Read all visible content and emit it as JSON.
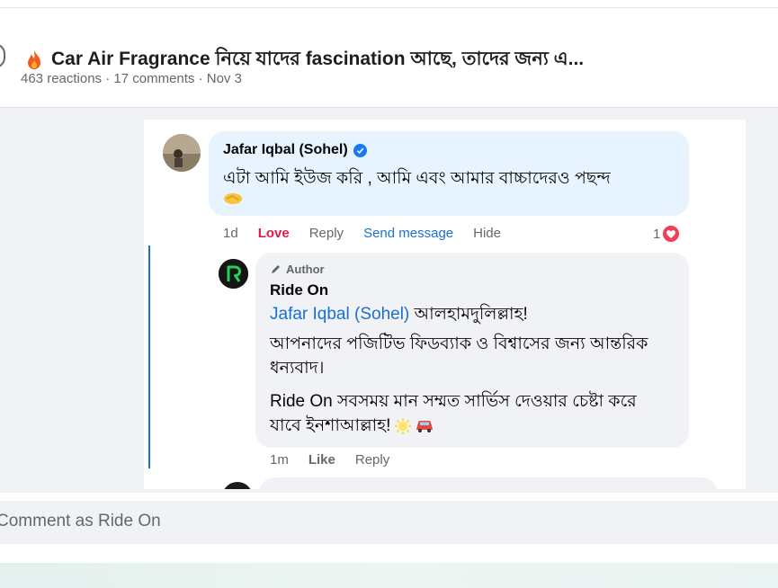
{
  "post": {
    "title": "Car Air Fragrance নিয়ে যাদের fascination আছে, তাদের জন্য এ...",
    "meta": "463 reactions · 17 comments · Nov 3",
    "title_icon": "fire-icon"
  },
  "comments": [
    {
      "author": "Jafar Iqbal (Sohel)",
      "verified": true,
      "text": "এটা আমি ইউজ করি , আমি এবং আমার বাচ্চাদেরও পছন্দ",
      "emoji": "handshake-emoji",
      "actions": {
        "time": "1d",
        "love": "Love",
        "reply": "Reply",
        "send_message": "Send message",
        "hide": "Hide"
      },
      "reaction_count": "1",
      "reaction_type": "heart",
      "bubble_color": "#e7f3ff"
    }
  ],
  "reply": {
    "badge": "Author",
    "author": "Ride On",
    "mention": "Jafar Iqbal (Sohel)",
    "line1_rest": " আলহামদুলিল্লাহ!",
    "para2": "আপনাদের পজিটিভ ফিডব্যাক ও বিশ্বাসের জন্য আন্তরিক ধন্যবাদ।",
    "para3": "Ride On সবসময় মান সম্মত সার্ভিস দেওয়ার চেষ্টা করে যাবে ইনশাআল্লাহ!",
    "emojis": [
      "sun-emoji",
      "car-emoji"
    ],
    "actions": {
      "time": "1m",
      "like": "Like",
      "reply": "Reply"
    },
    "thread_color": "#1a6fd1"
  },
  "composer": {
    "placeholder": "Comment as Ride On"
  },
  "colors": {
    "love": "#e4194b",
    "link": "#1a6fd1",
    "muted": "#65676b"
  }
}
